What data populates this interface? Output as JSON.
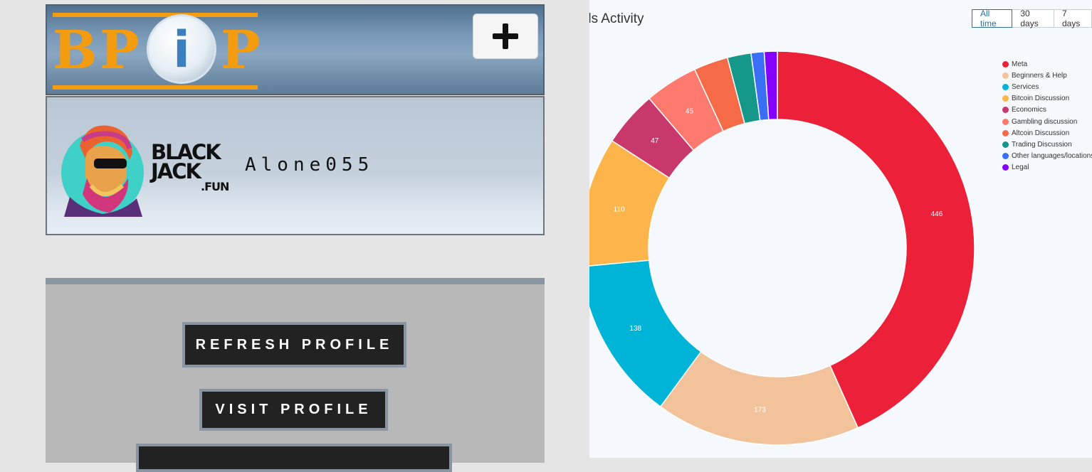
{
  "header": {
    "logo_letters": [
      "B",
      "P",
      "i",
      "P"
    ],
    "add_button_label": "+"
  },
  "profile": {
    "brand": {
      "line1": "BLACK",
      "line2": "JACK",
      "line3": ".FUN"
    },
    "username": "Alone055"
  },
  "actions": {
    "refresh_label": "REFRESH PROFILE",
    "visit_label": "VISIT PROFILE",
    "third_label": ""
  },
  "chart_panel": {
    "title": "ds Activity",
    "tabs": [
      {
        "label": "All time",
        "active": true
      },
      {
        "label": "30 days",
        "active": false
      },
      {
        "label": "7 days",
        "active": false
      }
    ]
  },
  "chart_data": {
    "type": "pie",
    "donut": true,
    "legend_position": "right",
    "series": [
      {
        "name": "Meta",
        "value": 446,
        "color": "#ec2139",
        "label": "446"
      },
      {
        "name": "Beginners & Help",
        "value": 173,
        "color": "#f2c39a",
        "label": "173"
      },
      {
        "name": "Services",
        "value": 138,
        "color": "#00b4d8",
        "label": "138"
      },
      {
        "name": "Bitcoin Discussion",
        "value": 110,
        "color": "#fdb44b",
        "label": "110"
      },
      {
        "name": "Economics",
        "value": 47,
        "color": "#c9386b",
        "label": "47"
      },
      {
        "name": "Gambling discussion",
        "value": 45,
        "color": "#ff7a6e",
        "label": "45"
      },
      {
        "name": "Altcoin Discussion",
        "value": 29,
        "color": "#f66b47",
        "label": ""
      },
      {
        "name": "Trading Discussion",
        "value": 20,
        "color": "#15988a",
        "label": ""
      },
      {
        "name": "Other languages/locations",
        "value": 11,
        "color": "#3a6ff5",
        "label": ""
      },
      {
        "name": "Legal",
        "value": 11,
        "color": "#8400ff",
        "label": ""
      }
    ]
  }
}
